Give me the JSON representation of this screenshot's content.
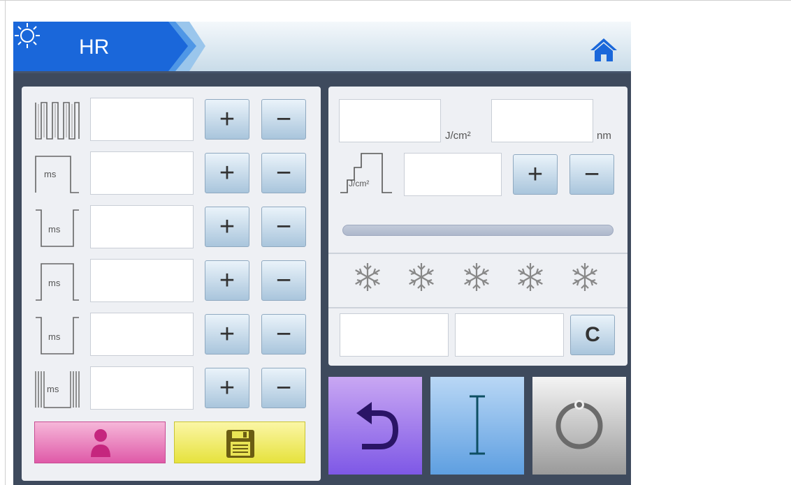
{
  "header": {
    "title": "HR",
    "mode_icon": "sun-icon",
    "home_icon": "home-icon",
    "accent_color": "#1f6fe0"
  },
  "left_rows": [
    {
      "icon": "pulse-train-icon",
      "icon_label": "",
      "value": "",
      "plus": "+",
      "minus": "−"
    },
    {
      "icon": "pulse-delay-icon",
      "icon_label": "ms",
      "value": "",
      "plus": "+",
      "minus": "−"
    },
    {
      "icon": "pulse-width-icon",
      "icon_label": "ms",
      "value": "",
      "plus": "+",
      "minus": "−"
    },
    {
      "icon": "pulse-rise-icon",
      "icon_label": "ms",
      "value": "",
      "plus": "+",
      "minus": "−"
    },
    {
      "icon": "pulse-fall-icon",
      "icon_label": "ms",
      "value": "",
      "plus": "+",
      "minus": "−"
    },
    {
      "icon": "pulse-interval-icon",
      "icon_label": "ms",
      "value": "",
      "plus": "+",
      "minus": "−"
    }
  ],
  "bottom_left": {
    "user_icon": "user-icon",
    "save_icon": "floppy-disk-icon",
    "user_color": "#df5aa8",
    "save_color": "#e6e23d"
  },
  "right": {
    "fluence": {
      "value": "",
      "unit": "J/cm²"
    },
    "wavelength": {
      "value": "",
      "unit": "nm"
    },
    "step": {
      "icon_label": "J/cm²",
      "value": "",
      "plus": "+",
      "minus": "−"
    },
    "cooling_levels": 5,
    "counter_a": "",
    "counter_b": "",
    "clear_label": "C"
  },
  "actions": {
    "undo_icon": "undo-arrow-icon",
    "ready_icon": "i-beam-icon",
    "power_icon": "power-icon",
    "undo_color": "#7e58e6",
    "ready_color": "#5e9fe1",
    "power_color": "#9a9a9a"
  }
}
